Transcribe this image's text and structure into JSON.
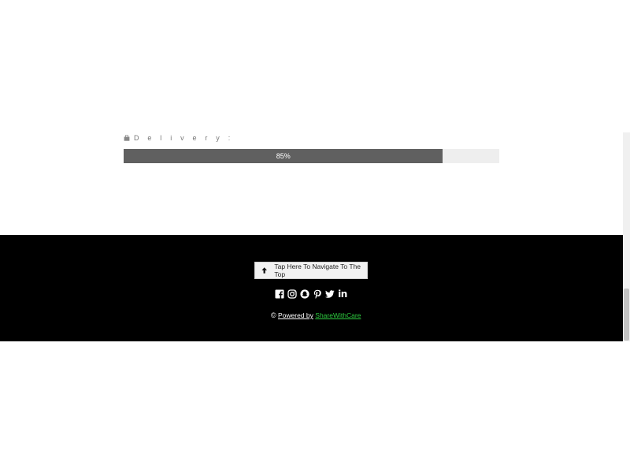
{
  "rating": {
    "label": "D e l i v e r y :",
    "percent_text": "85%",
    "fraction": 0.85,
    "fill_color": "#606060",
    "track_color": "#eeeeee",
    "icon": "shopping-bag-icon"
  },
  "footer": {
    "top_button_label": "Tap Here To Navigate To The Top",
    "top_button_icon": "arrow-up-icon",
    "social_icons": [
      "facebook-icon",
      "instagram-icon",
      "snapchat-icon",
      "pinterest-icon",
      "twitter-icon",
      "linkedin-icon"
    ],
    "linkedin_text": "in",
    "copyright_symbol": "©",
    "powered_text": "Powered by",
    "brand_name": "ShareWithCare",
    "brand_color": "#2ecc40",
    "background": "#000000"
  }
}
